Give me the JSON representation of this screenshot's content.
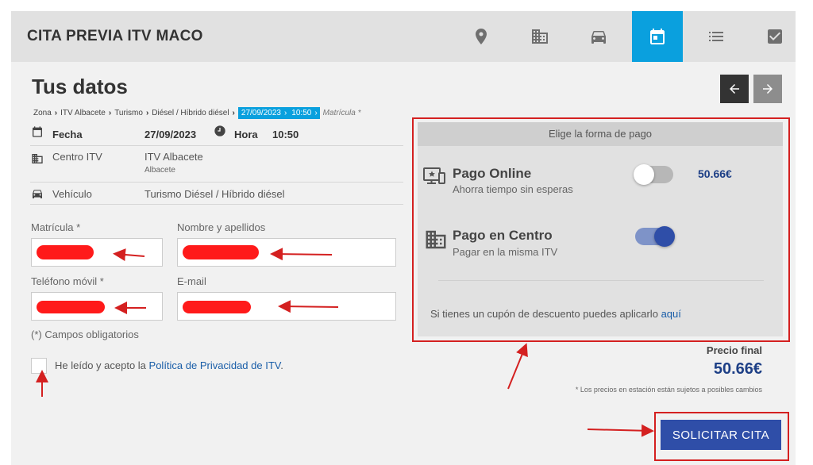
{
  "header": {
    "title": "CITA PREVIA ITV MACO",
    "steps": [
      "map-pin-icon",
      "building-icon",
      "car-icon",
      "calendar-icon",
      "list-icon",
      "checkbox-icon"
    ]
  },
  "page": {
    "title": "Tus datos"
  },
  "breadcrumb": {
    "items": [
      "Zona",
      "ITV Albacete",
      "Turismo",
      "Diésel / Híbrido diésel"
    ],
    "date": "27/09/2023",
    "time": "10:50",
    "last": "Matrícula *"
  },
  "summary": {
    "fecha_label": "Fecha",
    "fecha_value": "27/09/2023",
    "hora_label": "Hora",
    "hora_value": "10:50",
    "centro_label": "Centro ITV",
    "centro_value": "ITV Albacete",
    "centro_sub": "Albacete",
    "vehiculo_label": "Vehículo",
    "vehiculo_value": "Turismo Diésel / Híbrido diésel"
  },
  "form": {
    "matricula_label": "Matrícula *",
    "nombre_label": "Nombre y apellidos",
    "telefono_label": "Teléfono móvil *",
    "email_label": "E-mail",
    "required_note": "(*) Campos obligatorios",
    "privacy_text": "He leído y acepto la",
    "privacy_link": "Política de Privacidad de ITV",
    "privacy_end": "."
  },
  "payment": {
    "header": "Elige la forma de pago",
    "online_title": "Pago Online",
    "online_sub": "Ahorra tiempo sin esperas",
    "online_amount": "50.66€",
    "online_enabled": false,
    "centro_title": "Pago en Centro",
    "centro_sub": "Pagar en la misma ITV",
    "centro_enabled": true,
    "coupon_text": "Si tienes un cupón de descuento puedes aplicarlo",
    "coupon_link": "aquí"
  },
  "price": {
    "label": "Precio final",
    "value": "50.66€",
    "note": "* Los precios en estación están sujetos a posibles cambios"
  },
  "submit_label": "SOLICITAR CITA",
  "colors": {
    "accent": "#0aa0de",
    "primary": "#2f4ea8",
    "annotation": "#d42020",
    "redaction": "#ff1a1a"
  }
}
